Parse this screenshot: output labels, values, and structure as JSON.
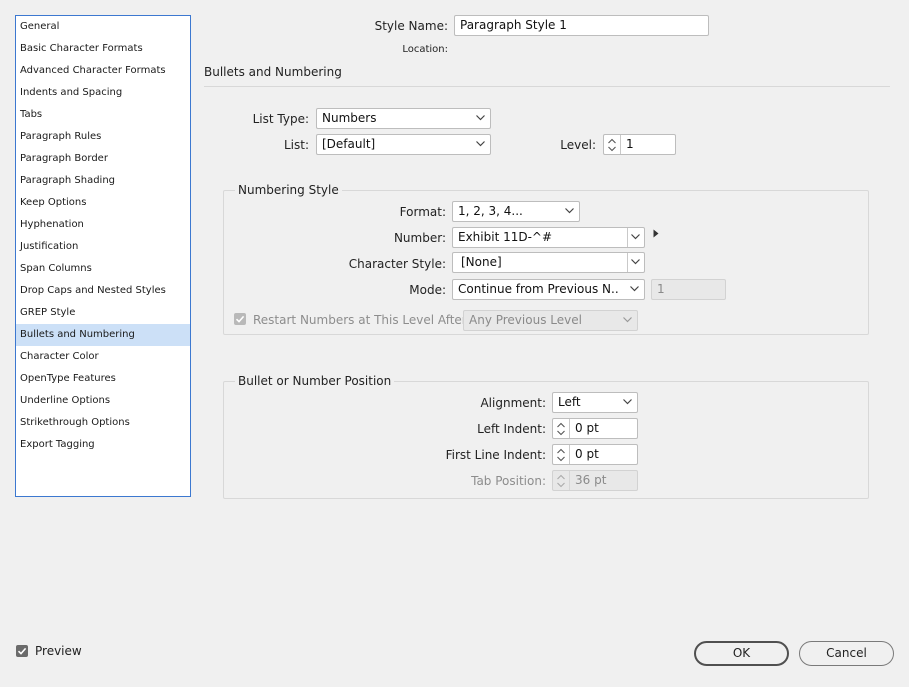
{
  "sidebar": {
    "items": [
      {
        "label": "General"
      },
      {
        "label": "Basic Character Formats"
      },
      {
        "label": "Advanced Character Formats"
      },
      {
        "label": "Indents and Spacing"
      },
      {
        "label": "Tabs"
      },
      {
        "label": "Paragraph Rules"
      },
      {
        "label": "Paragraph Border"
      },
      {
        "label": "Paragraph Shading"
      },
      {
        "label": "Keep Options"
      },
      {
        "label": "Hyphenation"
      },
      {
        "label": "Justification"
      },
      {
        "label": "Span Columns"
      },
      {
        "label": "Drop Caps and Nested Styles"
      },
      {
        "label": "GREP Style"
      },
      {
        "label": "Bullets and Numbering",
        "selected": true
      },
      {
        "label": "Character Color"
      },
      {
        "label": "OpenType Features"
      },
      {
        "label": "Underline Options"
      },
      {
        "label": "Strikethrough Options"
      },
      {
        "label": "Export Tagging"
      }
    ]
  },
  "header": {
    "style_name_label": "Style Name:",
    "style_name_value": "Paragraph Style 1",
    "location_label": "Location:",
    "section_title": "Bullets and Numbering"
  },
  "list": {
    "list_type_label": "List Type:",
    "list_type_value": "Numbers",
    "list_label": "List:",
    "list_value": "[Default]",
    "level_label": "Level:",
    "level_value": "1"
  },
  "numbering_style": {
    "title": "Numbering Style",
    "format_label": "Format:",
    "format_value": "1, 2, 3, 4...",
    "number_label": "Number:",
    "number_value": "Exhibit 11D-^#",
    "character_style_label": "Character Style:",
    "character_style_value": "[None]",
    "mode_label": "Mode:",
    "mode_value": "Continue from Previous N...",
    "mode_start_value": "1",
    "restart_label": "Restart Numbers at This Level After:",
    "restart_checked": true,
    "restart_value": "Any Previous Level"
  },
  "position": {
    "title": "Bullet or Number Position",
    "alignment_label": "Alignment:",
    "alignment_value": "Left",
    "left_indent_label": "Left Indent:",
    "left_indent_value": "0 pt",
    "first_line_indent_label": "First Line Indent:",
    "first_line_indent_value": "0 pt",
    "tab_position_label": "Tab Position:",
    "tab_position_value": "36 pt"
  },
  "footer": {
    "preview_label": "Preview",
    "preview_checked": true,
    "ok_label": "OK",
    "cancel_label": "Cancel"
  },
  "colors": {
    "selection": "#cce0f7",
    "sidebar_border": "#3c78d0",
    "background": "#f0f0f0"
  }
}
